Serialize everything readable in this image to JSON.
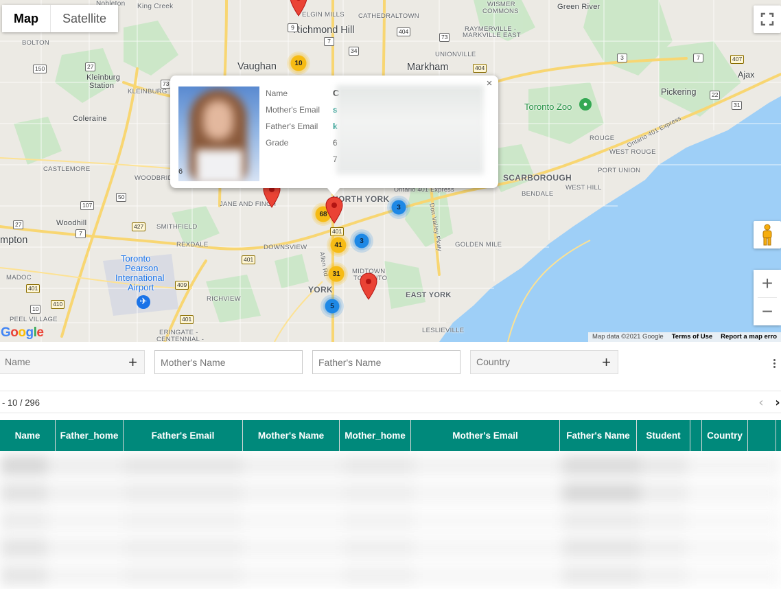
{
  "map": {
    "type_buttons": [
      "Map",
      "Satellite"
    ],
    "places": {
      "nobleton": "Nobleton",
      "king_creek": "King Creek",
      "bolton": "BOLTON",
      "elgin_mills": "ELGIN MILLS",
      "cathedraltown": "CATHEDRALTOWN",
      "wismer": "WISMER",
      "commons": "COMMONS",
      "green_river": "Green River",
      "richmond_hill": "Richmond Hill",
      "raymerville": "RAYMERVILLE -",
      "markville_east": "MARKVILLE EAST",
      "unionville": "UNIONVILLE",
      "kleinburg": "Kleinburg",
      "station": "Station",
      "vaughan": "Vaughan",
      "markham": "Markham",
      "ajax": "Ajax",
      "kleinburg_caps": "KLEINBURG",
      "pickering": "Pickering",
      "coleraine": "Coleraine",
      "toronto_zoo": "Toronto Zoo",
      "scarborough": "SCARBOROUGH",
      "rouge": "ROUGE",
      "west_rouge": "WEST ROUGE",
      "ontario_401_express": "Ontario 401 Express",
      "castlemore": "CASTLEMORE",
      "woodbridge": "WOODBRIDGE",
      "port_union": "PORT UNION",
      "west_hill": "WEST HILL",
      "jane_and_finch": "JANE AND FINCH",
      "north_york": "NORTH YORK",
      "ontario_401_express_2": "Ontario 401 Express",
      "bendale": "BENDALE",
      "woodhill": "Woodhill",
      "smithfield": "SMITHFIELD",
      "don_valley_pkwy": "Don Valley Pkwy",
      "mpton": "mpton",
      "rexdale": "REXDALE",
      "downsview": "DOWNSVIEW",
      "golden_mile": "GOLDEN MILE",
      "allen_rd": "Allen Rd",
      "toronto_pearson_1": "Toronto",
      "toronto_pearson_2": "Pearson",
      "toronto_pearson_3": "International",
      "toronto_pearson_4": "Airport",
      "midtown_1": "MIDTOWN",
      "midtown_2": "TORONTO",
      "madoc": "MADOC",
      "york": "YORK",
      "east_york": "EAST YORK",
      "richview": "RICHVIEW",
      "peel_village": "PEEL VILLAGE",
      "eringate": "ERINGATE -",
      "centennial": "CENTENNIAL -",
      "leslieville": "LESLIEVILLE"
    },
    "highway_shields": [
      "9",
      "404",
      "73",
      "150",
      "34",
      "7",
      "27",
      "3",
      "7",
      "407",
      "404",
      "73",
      "22",
      "31",
      "50",
      "107",
      "27",
      "427",
      "7",
      "401",
      "401",
      "409",
      "410",
      "401",
      "401",
      "10"
    ],
    "clusters": [
      {
        "count": "10",
        "color": "yellow"
      },
      {
        "count": "68",
        "color": "yellow"
      },
      {
        "count": "41",
        "color": "yellow"
      },
      {
        "count": "31",
        "color": "yellow"
      },
      {
        "count": "3",
        "color": "blue"
      },
      {
        "count": "3",
        "color": "blue"
      },
      {
        "count": "5",
        "color": "blue"
      }
    ],
    "attribution": {
      "data": "Map data ©2021 Google",
      "terms": "Terms of Use",
      "report": "Report a map erro"
    },
    "logo_letters": [
      "G",
      "o",
      "o",
      "g",
      "l",
      "e"
    ],
    "zoom_in": "+",
    "zoom_out": "−"
  },
  "infowindow": {
    "close": "×",
    "labels": [
      "Name",
      "Mother's Email",
      "Father's Email",
      "Grade"
    ],
    "values": [
      "C",
      "s",
      "k",
      "6",
      "7"
    ],
    "stray_char": "6"
  },
  "filters": {
    "name_placeholder": "Name",
    "mother_placeholder": "Mother's Name",
    "father_placeholder": "Father's Name",
    "country_placeholder": "Country",
    "plus": "+"
  },
  "pager": {
    "range": "- 10 / 296",
    "prev": "‹",
    "next": "›"
  },
  "table": {
    "columns": [
      "Name",
      "Father_home",
      "Father's Email",
      "Mother's Name",
      "Mother_home",
      "Mother's Email",
      "Father's Name",
      "Student",
      "",
      "Country",
      ""
    ]
  },
  "colors": {
    "header_teal": "#00897b",
    "cluster_yellow": "#f6bb14",
    "cluster_blue": "#1e88e5",
    "pin_red": "#ea4335",
    "water": "#9ecff7",
    "park": "#c8e6c9"
  }
}
